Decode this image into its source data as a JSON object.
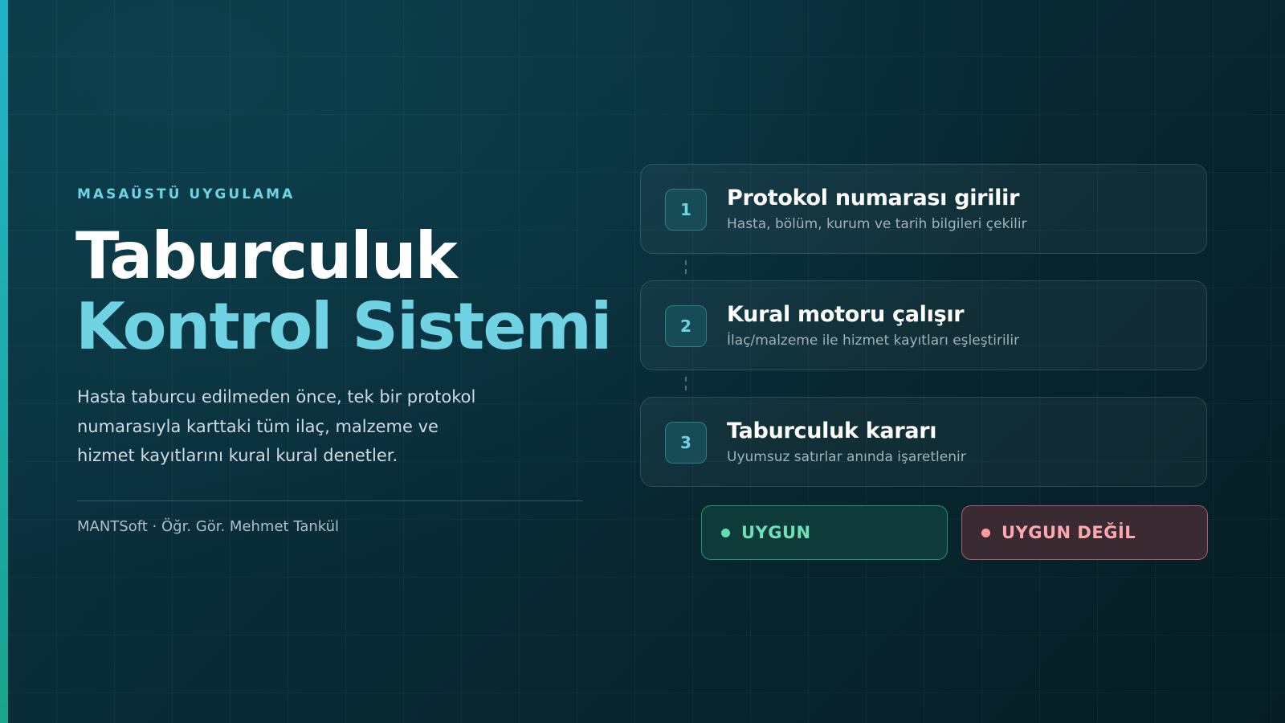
{
  "hero": {
    "eyebrow": "MASAÜSTÜ UYGULAMA",
    "title_line1": "Taburculuk",
    "title_line2": "Kontrol Sistemi",
    "description": "Hasta taburcu edilmeden önce, tek bir protokol numarasıyla karttaki tüm ilaç, malzeme ve hizmet kayıtlarını kural kural denetler.",
    "author": "MANTSoft · Öğr. Gör. Mehmet Tankül"
  },
  "steps": [
    {
      "number": "1",
      "title": "Protokol numarası girilir",
      "subtitle": "Hasta, bölüm, kurum ve tarih bilgileri çekilir"
    },
    {
      "number": "2",
      "title": "Kural motoru çalışır",
      "subtitle": "İlaç/malzeme ile hizmet kayıtları eşleştirilir"
    },
    {
      "number": "3",
      "title": "Taburculuk kararı",
      "subtitle": "Uyumsuz satırlar anında işaretlenir"
    }
  ],
  "status": {
    "ok_label": "UYGUN",
    "bad_label": "UYGUN DEĞİL"
  },
  "colors": {
    "accent": "#6fd3e3",
    "ok": "#5fe1b3",
    "bad": "#ff9aa3",
    "background": "#082a35"
  }
}
